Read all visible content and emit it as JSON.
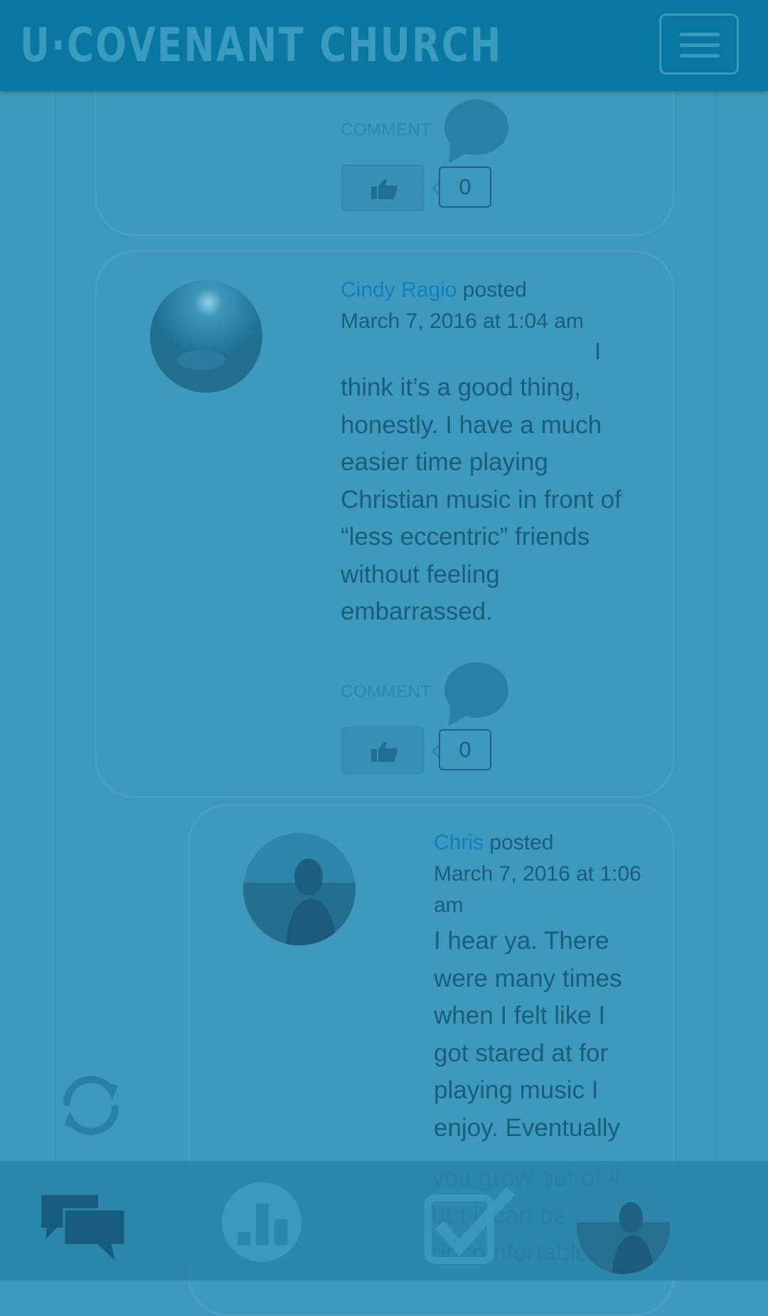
{
  "header": {
    "brand": "U·COVENANT CHURCH"
  },
  "icons": {
    "menu": "hamburger-menu-icon",
    "comment": "speech-bubble-icon",
    "like": "thumbs-up-icon",
    "refresh": "refresh-icon",
    "nav_discussions": "chat-bubbles-icon",
    "nav_stats": "bar-chart-icon",
    "nav_tasks": "checkbox-icon",
    "nav_profile": "avatar"
  },
  "card_top": {
    "comment_label": "COMMENT",
    "like_count": "0"
  },
  "post1": {
    "author": "Cindy Ragio",
    "posted": "posted",
    "date": "March 7, 2016 at 1:04 am",
    "text_lead": "I",
    "lines": [
      "think it’s a good thing,",
      "honestly. I have a much",
      "easier time playing",
      "Christian music in front of",
      "“less eccentric” friends",
      "without feeling",
      "embarrassed."
    ],
    "comment_label": "COMMENT",
    "like_count": "0"
  },
  "post2": {
    "author": "Chris",
    "posted": "posted",
    "date_line1": "March 7, 2016 at 1:06",
    "date_line2": "am",
    "lines": [
      "I hear ya. There",
      "were many times",
      "when I felt like I",
      "got stared at for",
      "playing music I",
      "enjoy. Eventually",
      "you grow out of it,",
      "but it can be",
      "uncomfortable"
    ]
  },
  "colors": {
    "header": "#0878a2",
    "background": "#3f9abd",
    "link": "#107fc2",
    "text": "#1b5e7c"
  }
}
